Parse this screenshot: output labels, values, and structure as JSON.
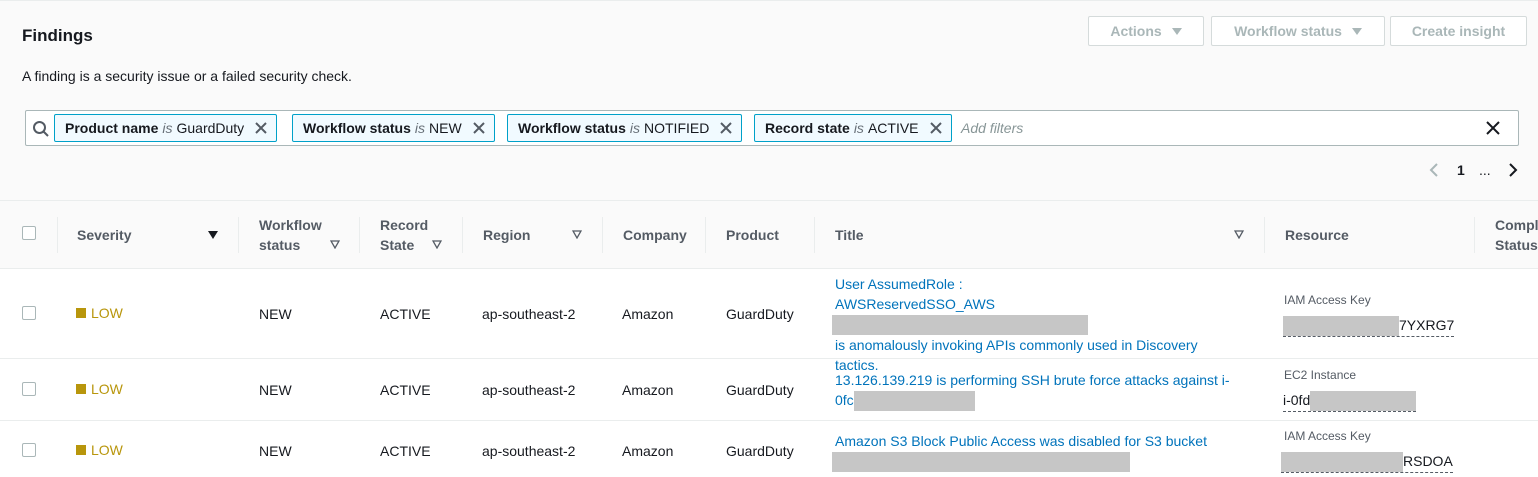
{
  "panel": {
    "title": "Findings",
    "description": "A finding is a security issue or a failed security check.",
    "buttons": {
      "actions": "Actions",
      "workflow_status": "Workflow status",
      "create_insight": "Create insight"
    }
  },
  "filters": {
    "tokens": [
      {
        "key": "Product name",
        "op": "is",
        "value": "GuardDuty"
      },
      {
        "key": "Workflow status",
        "op": "is",
        "value": "NEW"
      },
      {
        "key": "Workflow status",
        "op": "is",
        "value": "NOTIFIED"
      },
      {
        "key": "Record state",
        "op": "is",
        "value": "ACTIVE"
      }
    ],
    "placeholder": "Add filters"
  },
  "pagination": {
    "current": "1",
    "ellipsis": "..."
  },
  "columns": {
    "severity": "Severity",
    "workflow_status_1": "Workflow",
    "workflow_status_2": "status",
    "record_state_1": "Record",
    "record_state_2": "State",
    "region": "Region",
    "company": "Company",
    "product": "Product",
    "title": "Title",
    "resource": "Resource",
    "compliance_1": "Compl",
    "compliance_2": "Status"
  },
  "rows": [
    {
      "severity": "LOW",
      "workflow": "NEW",
      "record": "ACTIVE",
      "region": "ap-southeast-2",
      "company": "Amazon",
      "product": "GuardDuty",
      "title_1": "User AssumedRole :",
      "title_2": "AWSReservedSSO_AWS",
      "title_3": "is anomalously invoking APIs commonly used in Discovery",
      "title_4": "tactics.",
      "resource_type": "IAM Access Key",
      "resource_suffix": "7YXRG7"
    },
    {
      "severity": "LOW",
      "workflow": "NEW",
      "record": "ACTIVE",
      "region": "ap-southeast-2",
      "company": "Amazon",
      "product": "GuardDuty",
      "title_1": "13.126.139.219 is performing SSH brute force attacks against i-",
      "title_2": "0fc",
      "resource_type": "EC2 Instance",
      "resource_prefix": "i-0fd"
    },
    {
      "severity": "LOW",
      "workflow": "NEW",
      "record": "ACTIVE",
      "region": "ap-southeast-2",
      "company": "Amazon",
      "product": "GuardDuty",
      "title_1": "Amazon S3 Block Public Access was disabled for S3 bucket",
      "resource_type": "IAM Access Key",
      "resource_suffix": "RSDOA"
    }
  ],
  "colors": {
    "link": "#0073bb",
    "low_severity": "#b8960c",
    "token_border": "#00a1c9"
  }
}
